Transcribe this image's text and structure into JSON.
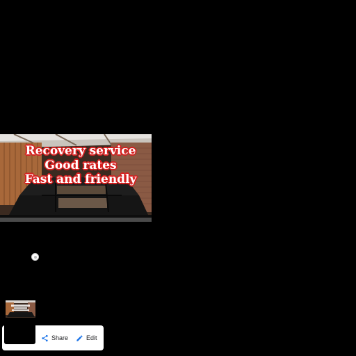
{
  "photo": {
    "overlay_lines": [
      "Recovery service",
      "Good rates",
      "Fast and friendly"
    ],
    "text_color": "#ffffff",
    "outline_color": "#d62020"
  },
  "actions": {
    "share_label": "Share",
    "edit_label": "Edit",
    "share_icon": "share-icon",
    "edit_icon": "pencil-icon",
    "icon_color": "#1a73e8"
  }
}
